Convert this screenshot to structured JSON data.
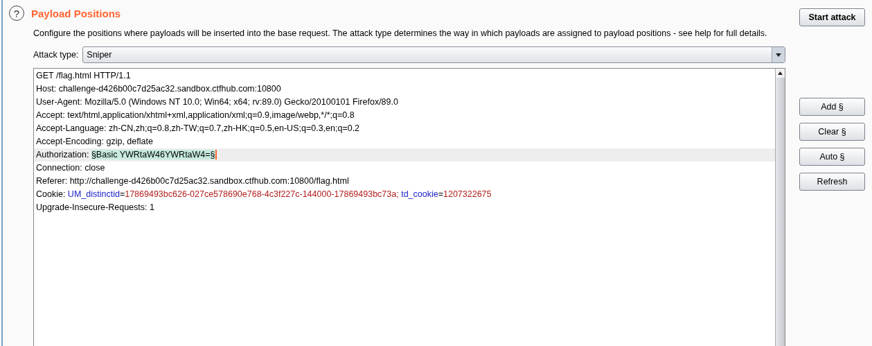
{
  "section": {
    "help_icon": "?",
    "title": "Payload Positions",
    "description": "Configure the positions where payloads will be inserted into the base request. The attack type determines the way in which payloads are assigned to payload positions - see help for full details."
  },
  "start_button": "Start attack",
  "attack_type": {
    "label": "Attack type:",
    "value": "Sniper"
  },
  "request_lines": [
    {
      "selected": false,
      "segments": [
        {
          "kind": "plain",
          "text": "GET /flag.html HTTP/1.1"
        }
      ]
    },
    {
      "selected": false,
      "segments": [
        {
          "kind": "plain",
          "text": "Host: challenge-d426b00c7d25ac32.sandbox.ctfhub.com:10800"
        }
      ]
    },
    {
      "selected": false,
      "segments": [
        {
          "kind": "plain",
          "text": "User-Agent: Mozilla/5.0 (Windows NT 10.0; Win64; x64; rv:89.0) Gecko/20100101 Firefox/89.0"
        }
      ]
    },
    {
      "selected": false,
      "segments": [
        {
          "kind": "plain",
          "text": "Accept: text/html,application/xhtml+xml,application/xml;q=0.9,image/webp,*/*;q=0.8"
        }
      ]
    },
    {
      "selected": false,
      "segments": [
        {
          "kind": "plain",
          "text": "Accept-Language: zh-CN,zh;q=0.8,zh-TW;q=0.7,zh-HK;q=0.5,en-US;q=0.3,en;q=0.2"
        }
      ]
    },
    {
      "selected": false,
      "segments": [
        {
          "kind": "plain",
          "text": "Accept-Encoding: gzip, deflate"
        }
      ]
    },
    {
      "selected": true,
      "segments": [
        {
          "kind": "plain",
          "text": "Authorization: "
        },
        {
          "kind": "payload",
          "text": "§Basic YWRtaW46YWRtaW4=§"
        }
      ]
    },
    {
      "selected": false,
      "segments": [
        {
          "kind": "plain",
          "text": "Connection: close"
        }
      ]
    },
    {
      "selected": false,
      "segments": [
        {
          "kind": "plain",
          "text": "Referer: http://challenge-d426b00c7d25ac32.sandbox.ctfhub.com:10800/flag.html"
        }
      ]
    },
    {
      "selected": false,
      "segments": [
        {
          "kind": "plain",
          "text": "Cookie: "
        },
        {
          "kind": "param_name",
          "text": "UM_distinctid"
        },
        {
          "kind": "plain",
          "text": "="
        },
        {
          "kind": "param_value",
          "text": "17869493bc626-027ce578690e768-4c3f227c-144000-17869493bc73a; "
        },
        {
          "kind": "param_name",
          "text": "td_cookie"
        },
        {
          "kind": "plain",
          "text": "="
        },
        {
          "kind": "param_value",
          "text": "1207322675"
        }
      ]
    },
    {
      "selected": false,
      "segments": [
        {
          "kind": "plain",
          "text": "Upgrade-Insecure-Requests: 1"
        }
      ]
    }
  ],
  "side_buttons": [
    "Add §",
    "Clear §",
    "Auto §",
    "Refresh"
  ]
}
